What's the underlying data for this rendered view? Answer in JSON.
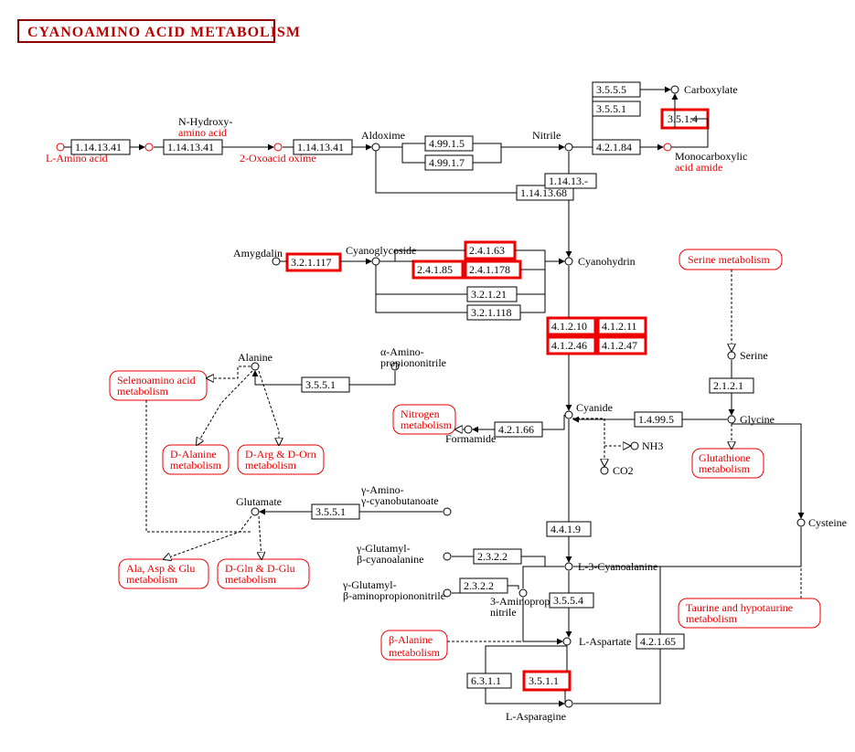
{
  "title": "CYANOAMINO ACID METABOLISM",
  "enzymes": {
    "e_3555": "3.5.5.5",
    "e_3551": "3.5.5.1",
    "e_3514": "3.5.1.4",
    "e_1141341a": "1.14.13.41",
    "e_1141341b": "1.14.13.41",
    "e_1141341c": "1.14.13.41",
    "e_49915": "4.99.1.5",
    "e_49917": "4.99.1.7",
    "e_42184": "4.2.1.84",
    "e_11413": "1.14.13.-",
    "e_1141368": "1.14.13.68",
    "e_321117": "3.2.1.117",
    "e_24163": "2.4.1.63",
    "e_24185": "2.4.1.85",
    "e_241178": "2.4.1.178",
    "e_32121": "3.2.1.21",
    "e_321118": "3.2.1.118",
    "e_41210": "4.1.2.10",
    "e_41211": "4.1.2.11",
    "e_41246": "4.1.2.46",
    "e_41247": "4.1.2.47",
    "e_3551b": "3.5.5.1",
    "e_42166": "4.2.1.66",
    "e_14995": "1.4.99.5",
    "e_2121": "2.1.2.1",
    "e_3551c": "3.5.5.1",
    "e_4419": "4.4.1.9",
    "e_2322a": "2.3.2.2",
    "e_2322b": "2.3.2.2",
    "e_3554": "3.5.5.4",
    "e_42165": "4.2.1.65",
    "e_6311": "6.3.1.1",
    "e_3511": "3.5.1.1"
  },
  "compounds": {
    "l_amino": "L-Amino acid",
    "nhydroxy1": "N-Hydroxy-",
    "nhydroxy2": "amino acid",
    "oxoacid": "2-Oxoacid oxime",
    "aldoxime": "Aldoxime",
    "nitrile": "Nitrile",
    "carboxylate": "Carboxylate",
    "monocarb1": "Monocarboxylic",
    "monocarb2": "acid amide",
    "amygdalin": "Amygdalin",
    "cyanoglyc": "Cyanoglycoside",
    "cyanohydrin": "Cyanohydrin",
    "cyanide": "Cyanide",
    "alanine": "Alanine",
    "aaminopn1": "α-Amino-",
    "aaminopn2": "propiononitrile",
    "formamide": "Formamide",
    "nh3": "NH3",
    "co2": "CO2",
    "glycine": "Glycine",
    "serine": "Serine",
    "cysteine": "Cysteine",
    "glutamate": "Glutamate",
    "gamino1": "γ-Amino-",
    "gamino2": "γ-cyanobutanoate",
    "gb1": "γ-Glutamyl-",
    "gb2": "β-cyanoalanine",
    "l3ca": "L-3-Cyanoalanine",
    "gap1": "γ-Glutamyl-",
    "gap2": "β-aminopropiononitrile",
    "apn1": "3-Aminopropiono-",
    "apn2": "nitrile",
    "lasp": "L-Aspartate",
    "lasn": "L-Asparagine"
  },
  "maps": {
    "serine": "Serine metabolism",
    "seleno1": "Selenoamino acid",
    "seleno2": "metabolism",
    "nitrogen1": "Nitrogen",
    "nitrogen2": "metabolism",
    "dala1": "D-Alanine",
    "dala2": "metabolism",
    "darg1": "D-Arg & D-Orn",
    "darg2": "metabolism",
    "glut1": "Glutathione",
    "glut2": "metabolism",
    "aag1": "Ala, Asp & Glu",
    "aag2": "metabolism",
    "dgln1": "D-Gln & D-Glu",
    "dgln2": "metabolism",
    "taurine1": "Taurine and hypotaurine",
    "taurine2": "metabolism",
    "bala1": "β-Alanine",
    "bala2": "metabolism"
  }
}
